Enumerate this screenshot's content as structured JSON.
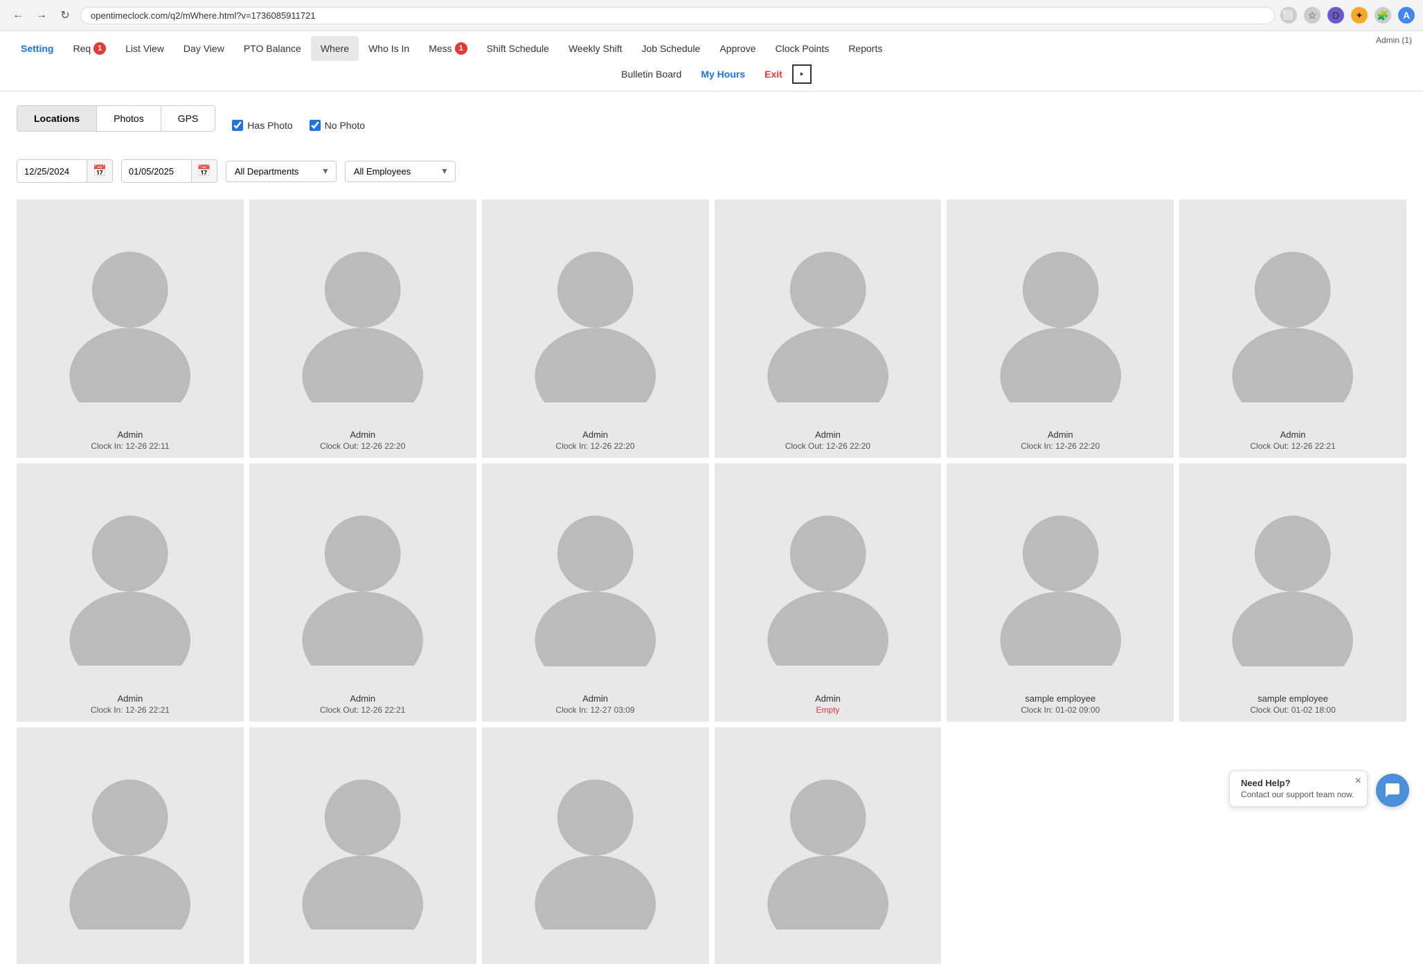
{
  "browser": {
    "url": "opentimeclock.com/q2/mWhere.html?v=1736085911721",
    "user_icon": "A"
  },
  "admin": {
    "label": "Admin (1)"
  },
  "nav": {
    "row1": [
      {
        "id": "setting",
        "label": "Setting",
        "badge": null,
        "active": false,
        "class": "setting"
      },
      {
        "id": "requests",
        "label": "Req",
        "badge": "1",
        "active": false
      },
      {
        "id": "list-view",
        "label": "List View",
        "badge": null,
        "active": false
      },
      {
        "id": "day-view",
        "label": "Day View",
        "badge": null,
        "active": false
      },
      {
        "id": "pto-balance",
        "label": "PTO Balance",
        "badge": null,
        "active": false
      },
      {
        "id": "where",
        "label": "Where",
        "badge": null,
        "active": true,
        "class": "active"
      },
      {
        "id": "who-is-in",
        "label": "Who Is In",
        "badge": null,
        "active": false
      },
      {
        "id": "messages",
        "label": "Mess",
        "badge": "1",
        "active": false
      },
      {
        "id": "shift-schedule",
        "label": "Shift Schedule",
        "badge": null,
        "active": false
      },
      {
        "id": "weekly-shift",
        "label": "Weekly Shift",
        "badge": null,
        "active": false
      },
      {
        "id": "job-schedule",
        "label": "Job Schedule",
        "badge": null,
        "active": false
      },
      {
        "id": "approve",
        "label": "Approve",
        "badge": null,
        "active": false
      },
      {
        "id": "clock-points",
        "label": "Clock Points",
        "badge": null,
        "active": false
      },
      {
        "id": "reports",
        "label": "Reports",
        "badge": null,
        "active": false
      }
    ],
    "row2": [
      {
        "id": "bulletin-board",
        "label": "Bulletin Board"
      },
      {
        "id": "my-hours",
        "label": "My Hours",
        "class": "myhours"
      },
      {
        "id": "exit",
        "label": "Exit",
        "class": "exit-btn"
      }
    ]
  },
  "tabs": [
    {
      "id": "locations",
      "label": "Locations",
      "active": true
    },
    {
      "id": "photos",
      "label": "Photos",
      "active": false
    },
    {
      "id": "gps",
      "label": "GPS",
      "active": false
    }
  ],
  "filters": {
    "has_photo": {
      "label": "Has Photo",
      "checked": true
    },
    "no_photo": {
      "label": "No Photo",
      "checked": true
    }
  },
  "date_start": "12/25/2024",
  "date_end": "01/05/2025",
  "department_options": [
    "All Departments"
  ],
  "department_selected": "All Departments",
  "employee_options": [
    "All Employees"
  ],
  "employee_selected": "All Employees",
  "photos": [
    {
      "name": "Admin",
      "status": "Clock In: 12-26 22:11",
      "empty": false
    },
    {
      "name": "Admin",
      "status": "Clock Out: 12-26 22:20",
      "empty": false
    },
    {
      "name": "Admin",
      "status": "Clock In: 12-26 22:20",
      "empty": false
    },
    {
      "name": "Admin",
      "status": "Clock Out: 12-26 22:20",
      "empty": false
    },
    {
      "name": "Admin",
      "status": "Clock In: 12-26 22:20",
      "empty": false
    },
    {
      "name": "Admin",
      "status": "Clock Out: 12-26 22:21",
      "empty": false
    },
    {
      "name": "Admin",
      "status": "Clock In: 12-26 22:21",
      "empty": false
    },
    {
      "name": "Admin",
      "status": "Clock Out: 12-26 22:21",
      "empty": false
    },
    {
      "name": "Admin",
      "status": "Clock In: 12-27 03:09",
      "empty": false
    },
    {
      "name": "Admin",
      "status": "Empty",
      "empty": true
    },
    {
      "name": "sample employee",
      "status": "Clock In: 01-02 09:00",
      "empty": false
    },
    {
      "name": "sample employee",
      "status": "Clock Out: 01-02 18:00",
      "empty": false
    },
    {
      "name": "",
      "status": "",
      "empty": false,
      "partial": true
    },
    {
      "name": "",
      "status": "",
      "empty": false,
      "partial": true
    },
    {
      "name": "",
      "status": "",
      "empty": false,
      "partial": true
    },
    {
      "name": "",
      "status": "",
      "empty": false,
      "partial": true
    }
  ],
  "help": {
    "title": "Need Help?",
    "subtitle": "Contact our support team now."
  }
}
